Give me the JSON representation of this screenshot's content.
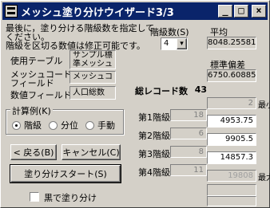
{
  "window": {
    "title": "メッシュ塗り分けウイザード3/3",
    "minimize": "_",
    "maximize": "□",
    "close": "×"
  },
  "instructions": {
    "line1": "最後に，塗り分ける階級数を指定して",
    "line2": "ください。",
    "line3": "階級を区切る数値は修正可能です。"
  },
  "fields": {
    "table_label": "使用テーブル",
    "table_value": "サンプル標",
    "table_value2": "準メッシュ",
    "mesh_label1": "メッシュコード",
    "mesh_label2": "フィールド",
    "mesh_value": "メッシュコード",
    "num_label": "数値フィールド",
    "num_value": "人口総数"
  },
  "classes": {
    "label": "階級数(S)",
    "value": "4",
    "arrow": "▾"
  },
  "stats": {
    "avg_label": "平均",
    "avg_value": "8048.25581",
    "std_label": "標準偏差",
    "std_value": "6750.60885",
    "total_label": "総レコード数",
    "total_value": "43"
  },
  "calc": {
    "label": "計算例(K)",
    "options": [
      "階級",
      "分位",
      "手動"
    ],
    "selected": "階級"
  },
  "buttons": {
    "back": "< 戻る(B)",
    "cancel": "キャンセル(C)",
    "start": "塗り分けスタート(S)"
  },
  "black_fill": {
    "label": "黒で塗り分け"
  },
  "ranges": {
    "min_label": "最小",
    "max_label": "最大",
    "min_value": "2",
    "max_value": "19808",
    "levels": [
      {
        "label": "第1階級",
        "count": "18",
        "upper": "4953.75"
      },
      {
        "label": "第2階級",
        "count": "6",
        "upper": "9905.5"
      },
      {
        "label": "第3階級",
        "count": "8",
        "upper": "14857.3"
      },
      {
        "label": "第4階級",
        "count": "11",
        "upper": "19808"
      }
    ]
  }
}
